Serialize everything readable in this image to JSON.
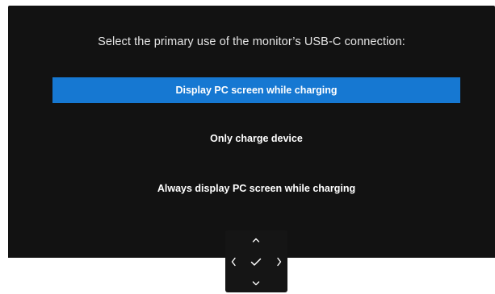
{
  "prompt": "Select the primary use of the monitor’s USB-C connection:",
  "options": [
    {
      "label": "Display PC screen while charging",
      "selected": true
    },
    {
      "label": "Only charge device",
      "selected": false
    },
    {
      "label": "Always display PC screen while charging",
      "selected": false
    }
  ],
  "nav": {
    "icons": [
      "chevron-up-icon",
      "chevron-left-icon",
      "checkmark-icon",
      "chevron-right-icon",
      "chevron-down-icon"
    ]
  },
  "colors": {
    "panel": "#121212",
    "selected": "#1678d2",
    "text": "#ffffff"
  }
}
